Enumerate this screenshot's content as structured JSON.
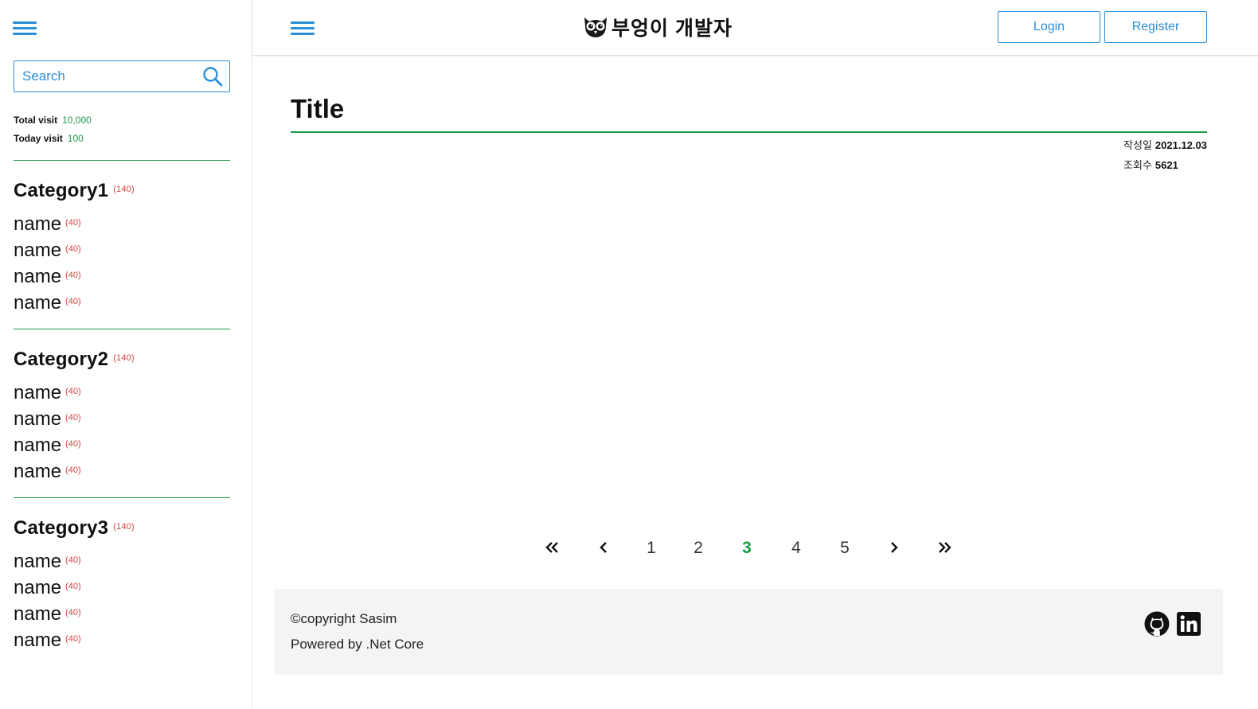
{
  "sidebar": {
    "search_placeholder": "Search",
    "stats": {
      "total_label": "Total visit",
      "total_value": "10,000",
      "today_label": "Today visit",
      "today_value": "100"
    },
    "categories": [
      {
        "title": "Category1",
        "count": "(140)",
        "items": [
          {
            "name": "name",
            "count": "(40)"
          },
          {
            "name": "name",
            "count": "(40)"
          },
          {
            "name": "name",
            "count": "(40)"
          },
          {
            "name": "name",
            "count": "(40)"
          }
        ]
      },
      {
        "title": "Category2",
        "count": "(140)",
        "items": [
          {
            "name": "name",
            "count": "(40)"
          },
          {
            "name": "name",
            "count": "(40)"
          },
          {
            "name": "name",
            "count": "(40)"
          },
          {
            "name": "name",
            "count": "(40)"
          }
        ]
      },
      {
        "title": "Category3",
        "count": "(140)",
        "items": [
          {
            "name": "name",
            "count": "(40)"
          },
          {
            "name": "name",
            "count": "(40)"
          },
          {
            "name": "name",
            "count": "(40)"
          },
          {
            "name": "name",
            "count": "(40)"
          }
        ]
      }
    ]
  },
  "header": {
    "brand": "부엉이 개발자",
    "login_label": "Login",
    "register_label": "Register"
  },
  "post": {
    "title": "Title",
    "date_label": "작성일",
    "date_value": "2021.12.03",
    "views_label": "조회수",
    "views_value": "5621"
  },
  "pagination": {
    "pages": [
      "1",
      "2",
      "3",
      "4",
      "5"
    ],
    "current": "3"
  },
  "footer": {
    "copyright": "©copyright Sasim",
    "powered": "Powered by .Net Core"
  },
  "colors": {
    "accent_blue": "#2a8fd8",
    "accent_green": "#1f9a4a",
    "count_red": "#d94141",
    "footer_bg": "#f4f4f4"
  }
}
